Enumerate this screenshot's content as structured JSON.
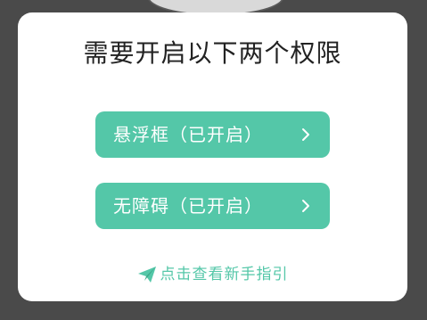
{
  "dialog": {
    "title": "需要开启以下两个权限",
    "permissions": [
      {
        "label": "悬浮框（已开启）",
        "icon": "chevron-right-icon"
      },
      {
        "label": "无障碍（已开启）",
        "icon": "chevron-right-icon"
      }
    ],
    "guide_link": {
      "label": "点击查看新手指引",
      "icon": "paper-plane-icon"
    }
  },
  "colors": {
    "accent": "#54c7a8",
    "backdrop": "#4a4a4a",
    "dialog_bg": "#ffffff",
    "title_text": "#222222"
  }
}
